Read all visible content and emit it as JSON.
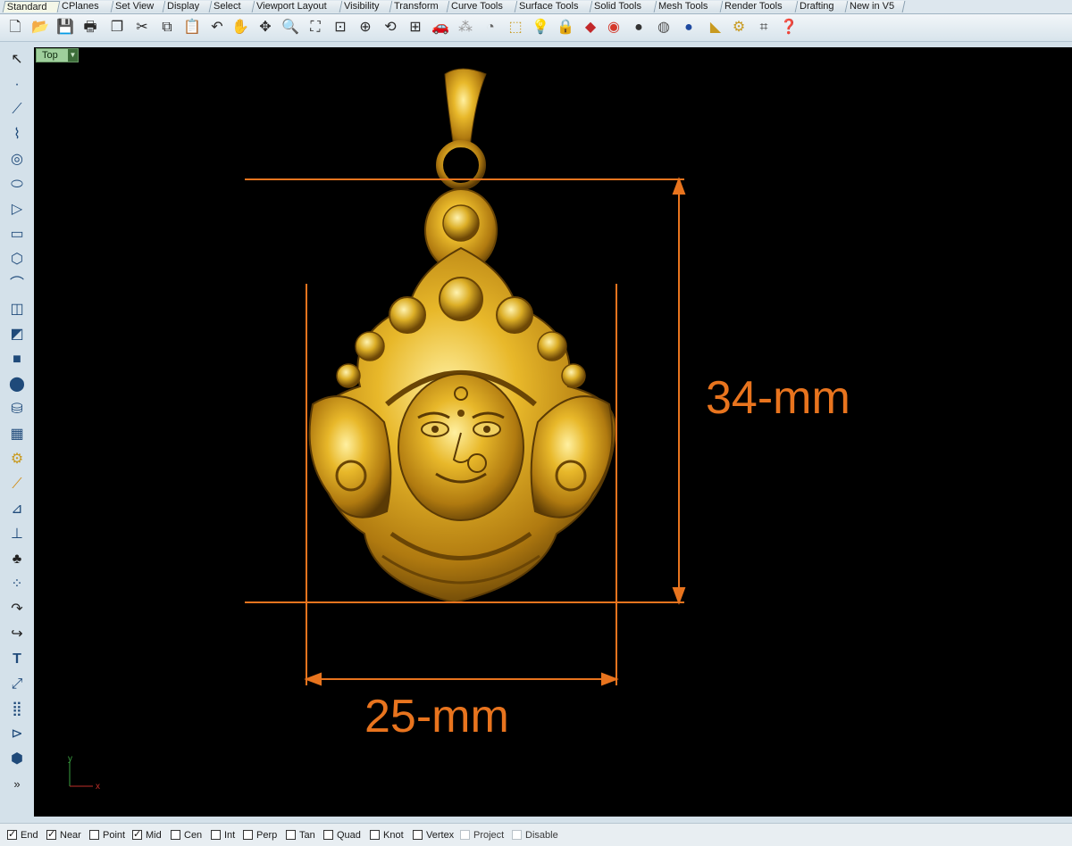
{
  "tabs": [
    "Standard",
    "CPlanes",
    "Set View",
    "Display",
    "Select",
    "Viewport Layout",
    "Visibility",
    "Transform",
    "Curve Tools",
    "Surface Tools",
    "Solid Tools",
    "Mesh Tools",
    "Render Tools",
    "Drafting",
    "New in V5"
  ],
  "viewport": {
    "name": "Top",
    "height_label": "34-mm",
    "width_label": "25-mm",
    "axis_y": "y",
    "axis_x": "x"
  },
  "snaps": [
    {
      "label": "End",
      "checked": true
    },
    {
      "label": "Near",
      "checked": true
    },
    {
      "label": "Point",
      "checked": false
    },
    {
      "label": "Mid",
      "checked": true
    },
    {
      "label": "Cen",
      "checked": false
    },
    {
      "label": "Int",
      "checked": false
    },
    {
      "label": "Perp",
      "checked": false
    },
    {
      "label": "Tan",
      "checked": false
    },
    {
      "label": "Quad",
      "checked": false
    },
    {
      "label": "Knot",
      "checked": false
    },
    {
      "label": "Vertex",
      "checked": false
    },
    {
      "label": "Project",
      "checked": false
    },
    {
      "label": "Disable",
      "checked": false
    }
  ],
  "colors": {
    "dimension": "#e8741e",
    "gold": "#d9a520",
    "viewport_bg": "#000000"
  }
}
